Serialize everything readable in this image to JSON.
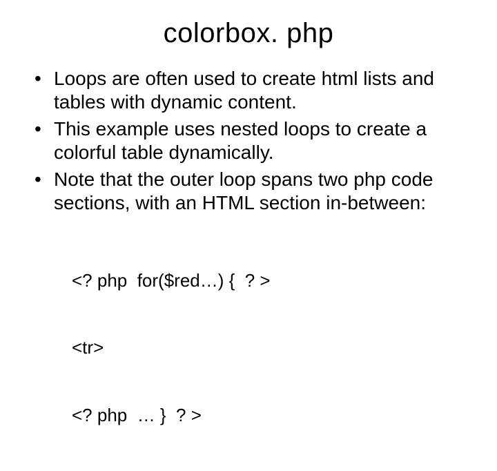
{
  "title": "colorbox. php",
  "bullets": [
    "Loops are often used to create html lists and tables with dynamic content.",
    "This example uses nested loops to create a colorful table dynamically.",
    "Note that the outer loop spans two php code sections, with an HTML section in-between:"
  ],
  "code_lines": [
    "<? php  for($red…) {  ? >",
    "<tr>",
    "<? php  … }  ? >"
  ]
}
